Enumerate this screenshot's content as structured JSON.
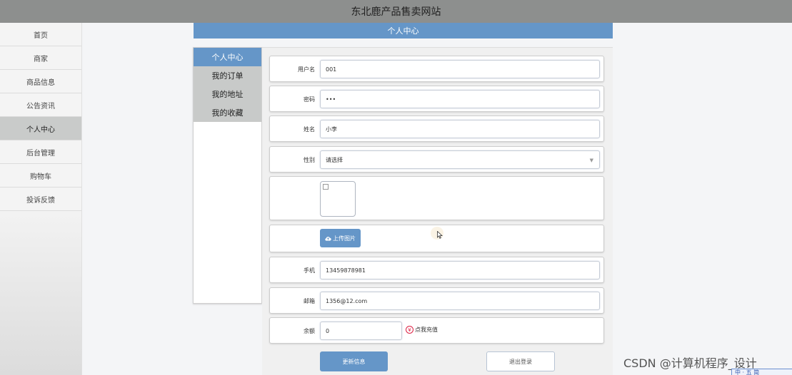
{
  "site": {
    "title": "东北鹿产品售卖网站"
  },
  "sidebar": {
    "items": [
      {
        "label": "首页"
      },
      {
        "label": "商家"
      },
      {
        "label": "商品信息"
      },
      {
        "label": "公告资讯"
      },
      {
        "label": "个人中心",
        "active": true
      },
      {
        "label": "后台管理"
      },
      {
        "label": "购物车"
      },
      {
        "label": "投诉反馈"
      }
    ]
  },
  "section": {
    "title": "个人中心"
  },
  "left_menu": {
    "items": [
      {
        "label": "个人中心",
        "active": true
      },
      {
        "label": "我的订单"
      },
      {
        "label": "我的地址"
      },
      {
        "label": "我的收藏"
      }
    ]
  },
  "form": {
    "username": {
      "label": "用户名",
      "value": "001"
    },
    "password": {
      "label": "密码",
      "value": "•••"
    },
    "name": {
      "label": "姓名",
      "value": "小李"
    },
    "gender": {
      "label": "性别",
      "value": "请选择"
    },
    "upload_label": "上传图片",
    "phone": {
      "label": "手机",
      "value": "13459878981"
    },
    "email": {
      "label": "邮箱",
      "value": "1356@12.com"
    },
    "balance": {
      "label": "余额",
      "value": "0"
    },
    "recharge_label": "点我充值",
    "update_button": "更新信息",
    "logout_button": "退出登录"
  },
  "watermark": "CSDN @计算机程序_设计",
  "corner_widget": "中 · 五 简"
}
